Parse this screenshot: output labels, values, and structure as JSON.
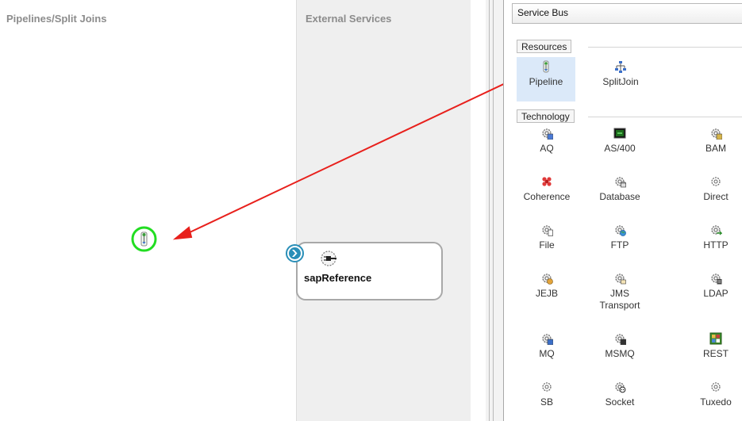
{
  "lanes": {
    "pipelines_title": "Pipelines/Split Joins",
    "external_title": "External Services"
  },
  "canvas": {
    "service_name": "sapReference"
  },
  "palette": {
    "header": "Service Bus",
    "resources_label": "Resources",
    "resources": [
      {
        "label": "Pipeline",
        "icon": "pipeline-icon",
        "selected": true
      },
      {
        "label": "SplitJoin",
        "icon": "splitjoin-icon",
        "selected": false
      }
    ],
    "technology_label": "Technology",
    "technology": [
      {
        "label": "AQ",
        "icon": "aq-icon"
      },
      {
        "label": "AS/400",
        "icon": "as400-icon"
      },
      {
        "label": "BAM",
        "icon": "bam-icon"
      },
      {
        "label": "Coherence",
        "icon": "coherence-icon"
      },
      {
        "label": "Database",
        "icon": "database-icon"
      },
      {
        "label": "Direct",
        "icon": "direct-icon"
      },
      {
        "label": "File",
        "icon": "file-icon"
      },
      {
        "label": "FTP",
        "icon": "ftp-icon"
      },
      {
        "label": "HTTP",
        "icon": "http-icon"
      },
      {
        "label": "JEJB",
        "icon": "jejb-icon"
      },
      {
        "label": "JMS Transport",
        "line1": "JMS",
        "line2": "Transport",
        "icon": "jms-icon"
      },
      {
        "label": "LDAP",
        "icon": "ldap-icon"
      },
      {
        "label": "MQ",
        "icon": "mq-icon"
      },
      {
        "label": "MSMQ",
        "icon": "msmq-icon"
      },
      {
        "label": "REST",
        "icon": "rest-icon"
      },
      {
        "label": "SB",
        "icon": "sb-icon"
      },
      {
        "label": "Socket",
        "icon": "socket-icon"
      },
      {
        "label": "Tuxedo",
        "icon": "tuxedo-icon"
      }
    ]
  },
  "colors": {
    "drag_arrow": "#e8201c",
    "drop_ring": "#22dd22",
    "selection": "#dbe9f9",
    "connector": "#2a8fb8"
  }
}
